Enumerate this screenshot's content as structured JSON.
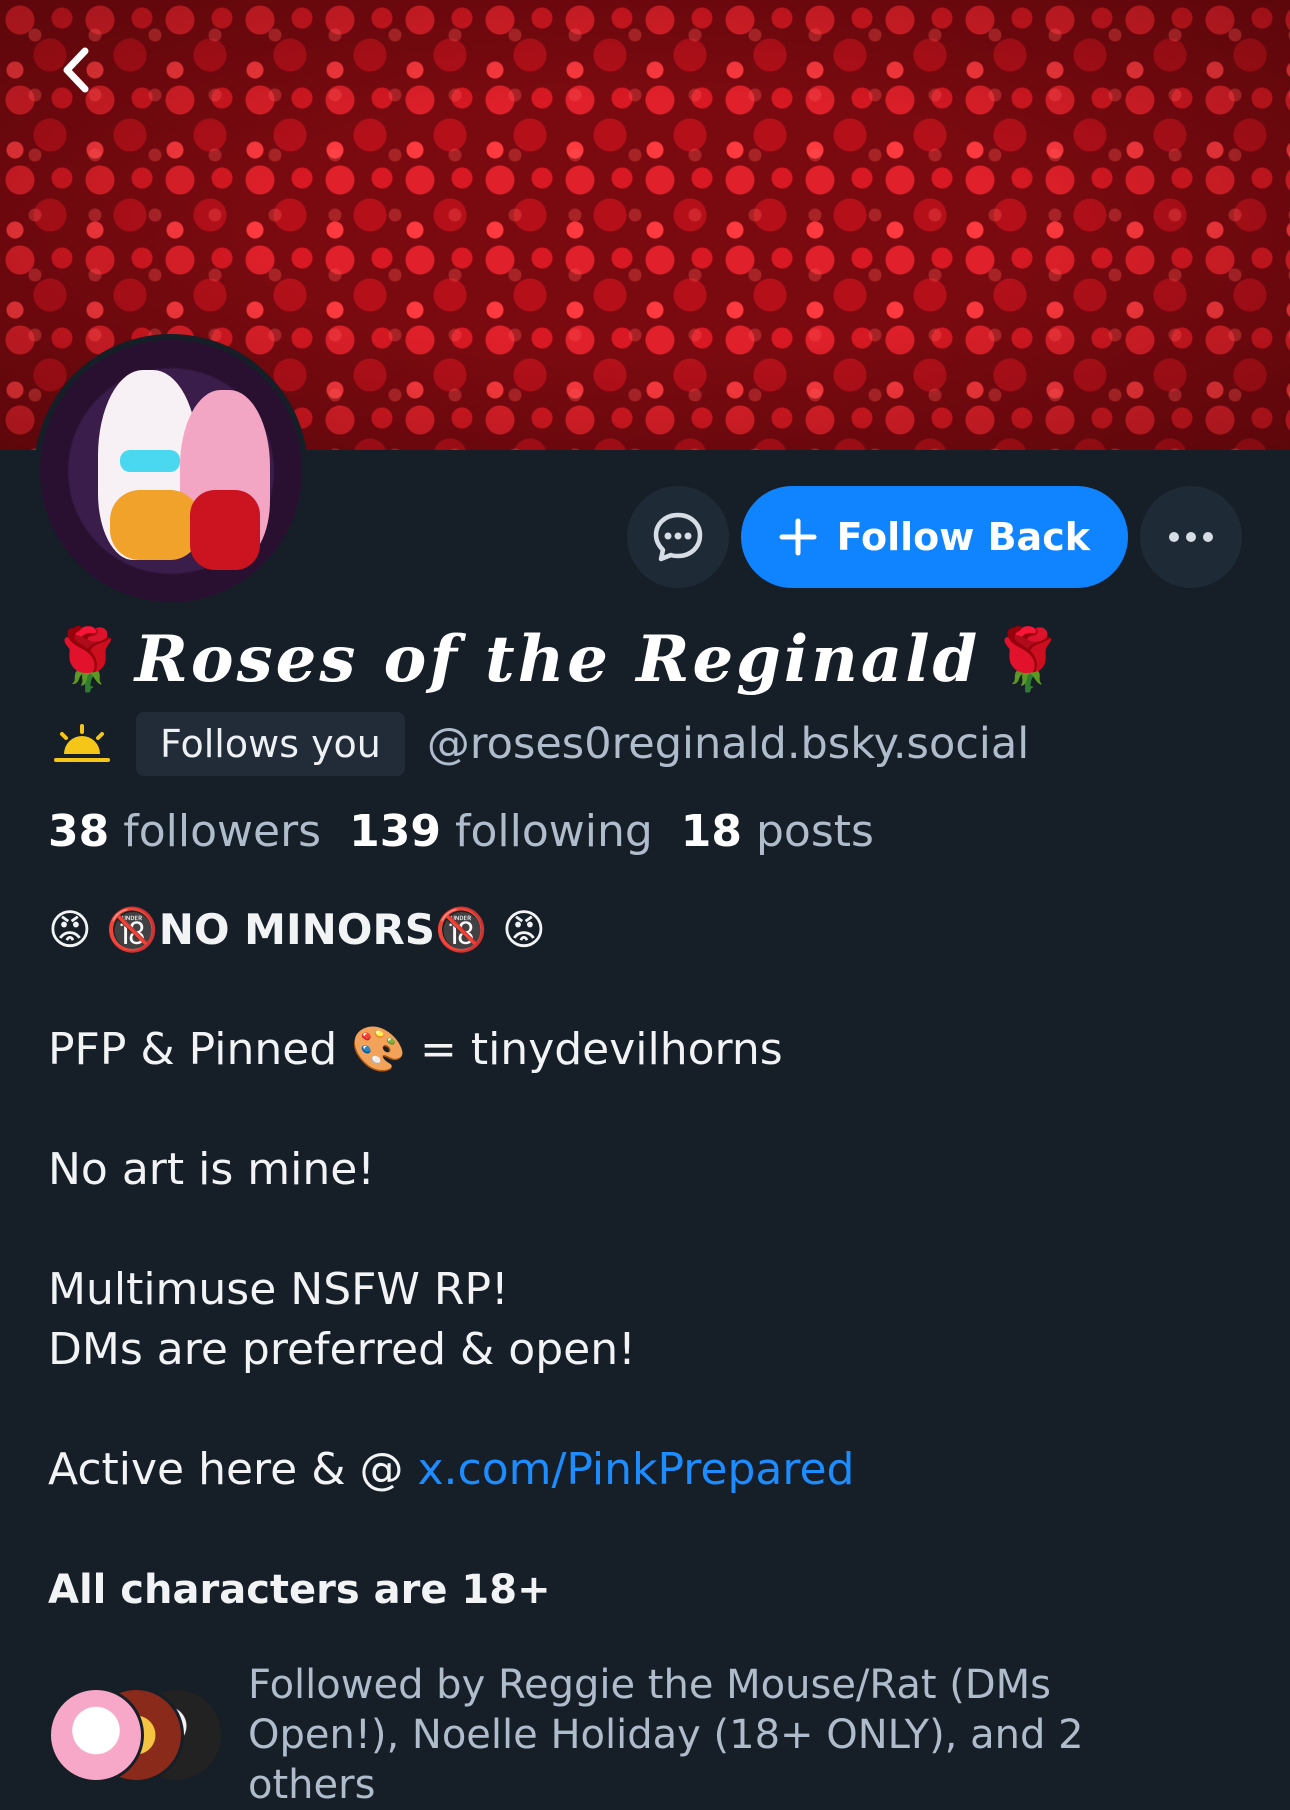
{
  "header": {
    "back_icon": "chevron-left-icon"
  },
  "profile": {
    "display_name": "Roses of the Reginald",
    "name_prefix_emoji": "🌹",
    "name_suffix_emoji": "🌹",
    "status_icon": "sunrise-icon",
    "follows_you_label": "Follows you",
    "handle": "@roses0reginald.bsky.social"
  },
  "actions": {
    "message_icon": "chat-bubble-icon",
    "follow_back_label": "Follow Back",
    "more_icon": "more-horizontal-icon"
  },
  "stats": {
    "followers_count": "38",
    "followers_label": "followers",
    "following_count": "139",
    "following_label": "following",
    "posts_count": "18",
    "posts_label": "posts"
  },
  "bio": {
    "line1": "😡 🔞NO MINORS🔞 😡",
    "line2": "PFP & Pinned 🎨 = tinydevilhorns",
    "line3": "No art is mine!",
    "line4": "Multimuse NSFW RP!",
    "line5": "DMs are preferred & open!",
    "line6_prefix": "Active here & @ ",
    "line6_link": "x.com/PinkPrepared",
    "line7": "All characters are 18+"
  },
  "followed_by": {
    "text": "Followed by Reggie the Mouse/Rat (DMs Open!), Noelle Holiday (18+ ONLY), and 2 others"
  },
  "colors": {
    "background": "#161e27",
    "accent": "#1083fe",
    "link": "#1c8cff",
    "muted_text": "#aebccb"
  }
}
